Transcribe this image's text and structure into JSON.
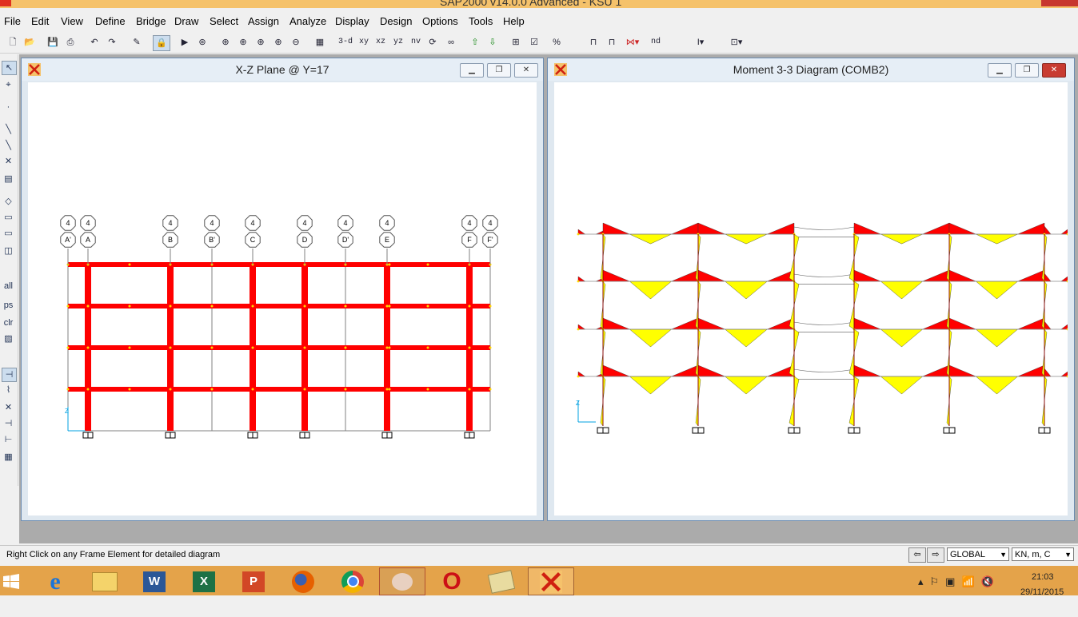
{
  "app": {
    "title": "SAP2000 v14.0.0 Advanced - KSU 1"
  },
  "menu": [
    "File",
    "Edit",
    "View",
    "Define",
    "Bridge",
    "Draw",
    "Select",
    "Assign",
    "Analyze",
    "Display",
    "Design",
    "Options",
    "Tools",
    "Help"
  ],
  "toolbar": {
    "view_3d": "3-d",
    "view_xy": "xy",
    "view_xz": "xz",
    "view_yz": "yz",
    "view_nv": "nv",
    "nd": "nd"
  },
  "left_toolbar": {
    "all": "all",
    "ps": "ps",
    "clr": "clr"
  },
  "window_left": {
    "title": "X-Z Plane @ Y=17",
    "grid_top_labels": [
      "4",
      "4",
      "4",
      "4",
      "4",
      "4",
      "4",
      "4",
      "4",
      "4"
    ],
    "grid_labels": [
      "A'",
      "A",
      "B",
      "B'",
      "C",
      "D",
      "D'",
      "E",
      "F",
      "F'"
    ],
    "axis_label": "Z"
  },
  "window_right": {
    "title": "Moment 3-3 Diagram   (COMB2)",
    "axis_label": "Z"
  },
  "status": {
    "message": "Right Click on any Frame Element for detailed diagram",
    "coord_system": "GLOBAL",
    "units": "KN, m, C"
  },
  "taskbar": {
    "time": "21:03",
    "date": "29/11/2015",
    "apps": [
      {
        "name": "internet-explorer",
        "label": "e"
      },
      {
        "name": "file-explorer",
        "label": ""
      },
      {
        "name": "word",
        "label": "W"
      },
      {
        "name": "excel",
        "label": "X"
      },
      {
        "name": "powerpoint",
        "label": "P"
      },
      {
        "name": "firefox",
        "label": ""
      },
      {
        "name": "chrome",
        "label": ""
      },
      {
        "name": "paint",
        "label": ""
      },
      {
        "name": "opera",
        "label": "O"
      },
      {
        "name": "folder",
        "label": ""
      },
      {
        "name": "sap2000",
        "label": ""
      }
    ]
  },
  "colors": {
    "frame_red": "#ff0000",
    "moment_yellow": "#ffff00",
    "taskbar": "#e4a34a",
    "canvas": "#ffffff"
  }
}
